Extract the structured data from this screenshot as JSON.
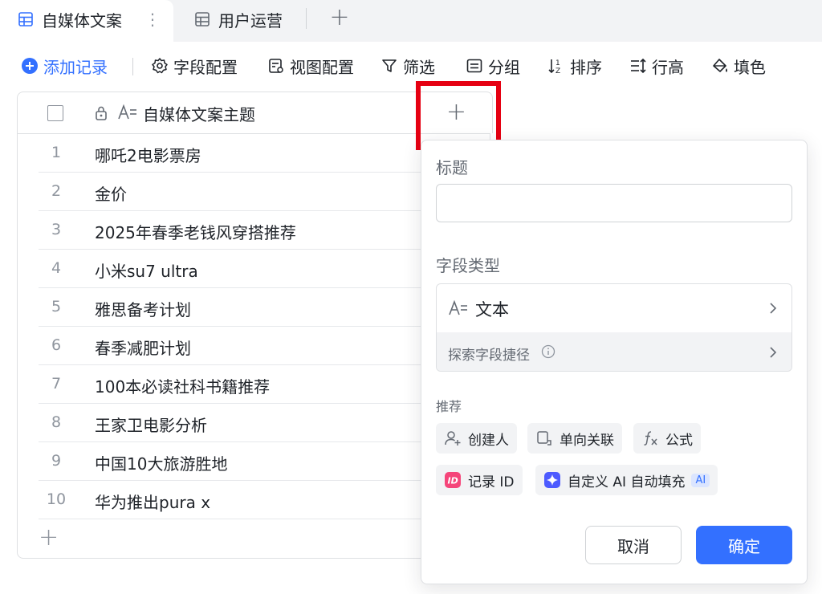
{
  "tabs": [
    {
      "label": "自媒体文案",
      "active": true
    },
    {
      "label": "用户运营",
      "active": false
    }
  ],
  "toolbar": {
    "add_record": "添加记录",
    "field_config": "字段配置",
    "view_config": "视图配置",
    "filter": "筛选",
    "group": "分组",
    "sort": "排序",
    "row_height": "行高",
    "fill_color": "填色"
  },
  "table": {
    "primary_column": "自媒体文案主题",
    "rows": [
      {
        "num": "1",
        "text": "哪吒2电影票房"
      },
      {
        "num": "2",
        "text": "金价"
      },
      {
        "num": "3",
        "text": "2025年春季老钱风穿搭推荐"
      },
      {
        "num": "4",
        "text": "小米su7 ultra"
      },
      {
        "num": "5",
        "text": "雅思备考计划"
      },
      {
        "num": "6",
        "text": "春季减肥计划"
      },
      {
        "num": "7",
        "text": "100本必读社科书籍推荐"
      },
      {
        "num": "8",
        "text": "王家卫电影分析"
      },
      {
        "num": "9",
        "text": "中国10大旅游胜地"
      },
      {
        "num": "10",
        "text": "华为推出pura x"
      }
    ]
  },
  "popover": {
    "title_label": "标题",
    "title_value": "",
    "field_type_label": "字段类型",
    "field_type_value": "文本",
    "explore_shortcut": "探索字段捷径",
    "recommend_label": "推荐",
    "chips": {
      "creator": "创建人",
      "one_way_link": "单向关联",
      "formula": "公式",
      "record_id": "记录 ID",
      "ai_fill": "自定义 AI 自动填充",
      "ai_badge": "AI"
    },
    "cancel": "取消",
    "confirm": "确定"
  },
  "colors": {
    "accent": "#3370ff",
    "highlight": "#e60012",
    "record_id_icon": "#f5457a",
    "ai_icon": "#4d5bff"
  }
}
